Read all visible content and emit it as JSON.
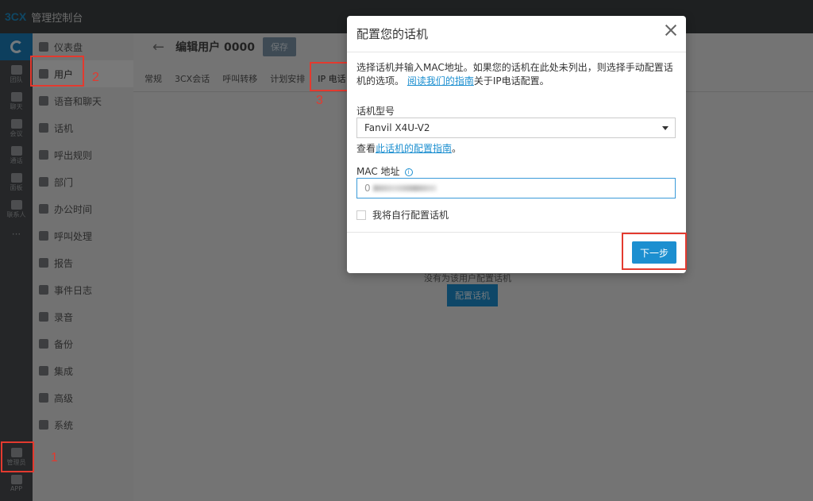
{
  "app": {
    "logo": "3CX",
    "title": "管理控制台"
  },
  "rail": {
    "items": [
      {
        "label": "团队",
        "icon": "team-icon"
      },
      {
        "label": "聊天",
        "icon": "chat-icon"
      },
      {
        "label": "会议",
        "icon": "meeting-icon"
      },
      {
        "label": "通话",
        "icon": "call-history-icon"
      },
      {
        "label": "面板",
        "icon": "panel-icon"
      },
      {
        "label": "联系人",
        "icon": "contacts-icon"
      },
      {
        "label": "···",
        "icon": "more-icon"
      },
      {
        "label": "管理员",
        "icon": "gear-icon"
      },
      {
        "label": "APP",
        "icon": "app-icon"
      }
    ]
  },
  "nav": {
    "items": [
      {
        "label": "仪表盘",
        "icon": "dashboard-icon"
      },
      {
        "label": "用户",
        "icon": "user-icon"
      },
      {
        "label": "语音和聊天",
        "icon": "globe-icon"
      },
      {
        "label": "话机",
        "icon": "phone-icon"
      },
      {
        "label": "呼出规则",
        "icon": "arrow-up-icon"
      },
      {
        "label": "部门",
        "icon": "group-icon"
      },
      {
        "label": "办公时间",
        "icon": "clock-icon"
      },
      {
        "label": "呼叫处理",
        "icon": "handset-icon"
      },
      {
        "label": "报告",
        "icon": "report-icon"
      },
      {
        "label": "事件日志",
        "icon": "history-icon"
      },
      {
        "label": "录音",
        "icon": "record-icon"
      },
      {
        "label": "备份",
        "icon": "archive-icon"
      },
      {
        "label": "集成",
        "icon": "puzzle-icon"
      },
      {
        "label": "高级",
        "icon": "cog-icon"
      },
      {
        "label": "系统",
        "icon": "wrench-icon"
      }
    ]
  },
  "page": {
    "title": "编辑用户 0000",
    "save_label": "保存",
    "tabs": [
      "常规",
      "3CX会话",
      "呼叫转移",
      "计划安排",
      "IP 电话"
    ],
    "empty_text": "没有为该用户配置话机",
    "config_button": "配置话机"
  },
  "modal": {
    "title": "配置您的话机",
    "desc_part1": "选择话机并输入MAC地址。如果您的话机在此处未列出，则选择手动配置话机的选项。",
    "desc_link": "阅读我们的指南",
    "desc_part2": "关于IP电话配置。",
    "model_label": "话机型号",
    "model_value": "Fanvil X4U-V2",
    "guide_prefix": "查看",
    "guide_link": "此话机的配置指南",
    "guide_suffix": "。",
    "mac_label": "MAC 地址",
    "mac_value_prefix": "0",
    "manual_label": "我将自行配置话机",
    "next_label": "下一步"
  },
  "annotations": [
    "1",
    "2",
    "3"
  ],
  "colors": {
    "accent": "#1c8fd0",
    "annotation": "#e33a2f"
  }
}
